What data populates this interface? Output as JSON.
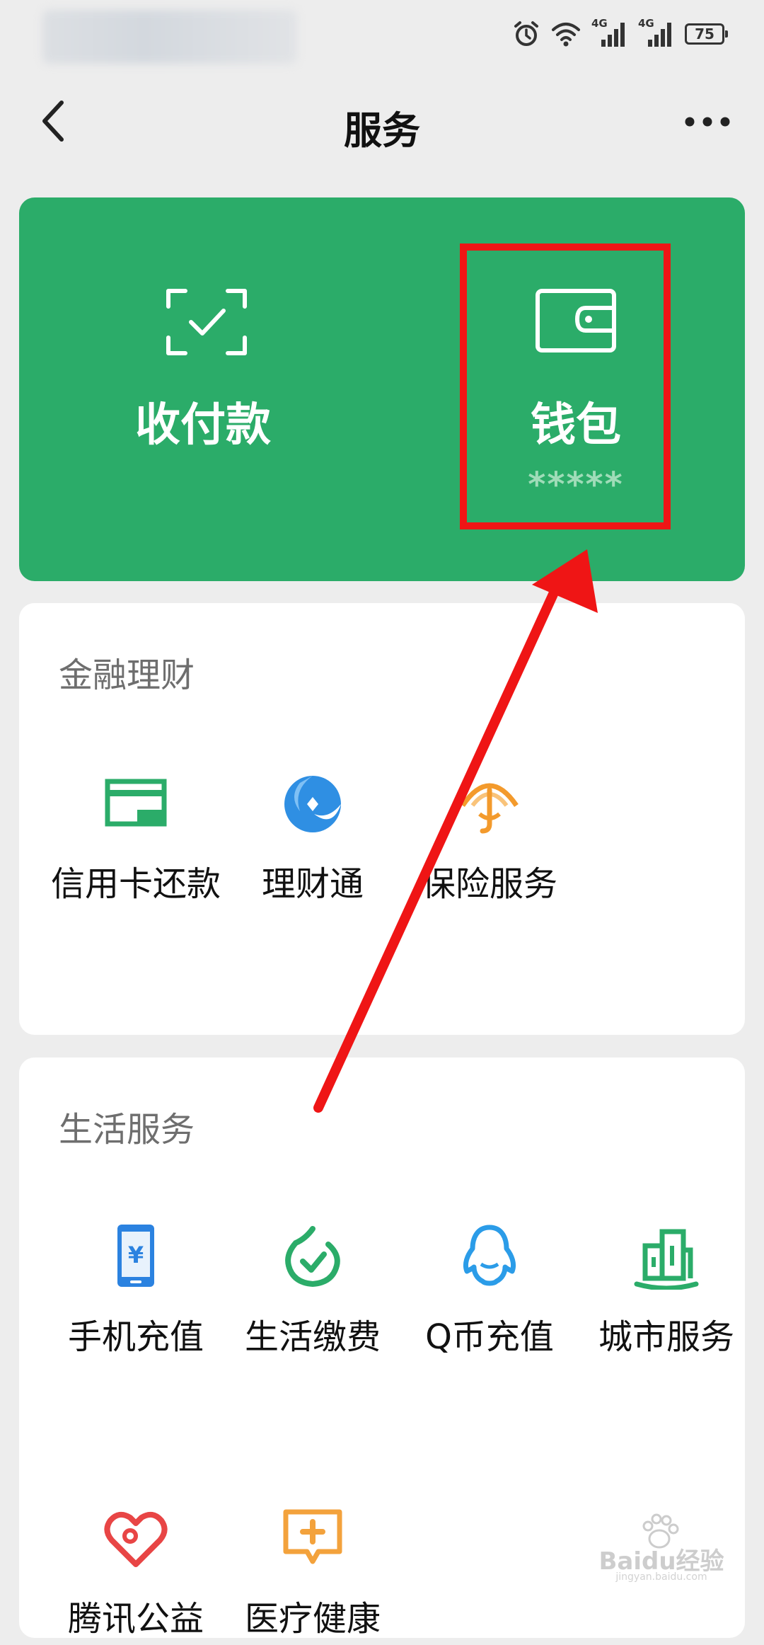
{
  "status_bar": {
    "battery_level": "75",
    "network_label_1": "4G",
    "network_label_2": "4G"
  },
  "header": {
    "title": "服务"
  },
  "wallet_card": {
    "pay_label": "收付款",
    "wallet_label": "钱包",
    "wallet_balance": "*****",
    "background_color": "#2bac69"
  },
  "finance_section": {
    "title": "金融理财",
    "items": [
      {
        "label": "信用卡还款",
        "icon": "credit-card-icon",
        "color": "#2bac69"
      },
      {
        "label": "理财通",
        "icon": "licaitong-icon",
        "color": "#2f8fe3"
      },
      {
        "label": "保险服务",
        "icon": "insurance-umbrella-icon",
        "color": "#f39a2c"
      }
    ]
  },
  "life_section": {
    "title": "生活服务",
    "items": [
      {
        "label": "手机充值",
        "icon": "mobile-topup-icon",
        "color": "#2b82e0"
      },
      {
        "label": "生活缴费",
        "icon": "utility-payment-icon",
        "color": "#2bac69"
      },
      {
        "label": "Q币充值",
        "icon": "qq-penguin-icon",
        "color": "#2b9ce8"
      },
      {
        "label": "城市服务",
        "icon": "city-buildings-icon",
        "color": "#2bac69"
      },
      {
        "label": "腾讯公益",
        "icon": "charity-heart-icon",
        "color": "#e84545"
      },
      {
        "label": "医疗健康",
        "icon": "medical-chat-icon",
        "color": "#f3a23c"
      }
    ]
  },
  "watermark": {
    "text": "Baidu经验",
    "subtext": "jingyan.baidu.com"
  },
  "annotation": {
    "color": "#ef1515"
  }
}
